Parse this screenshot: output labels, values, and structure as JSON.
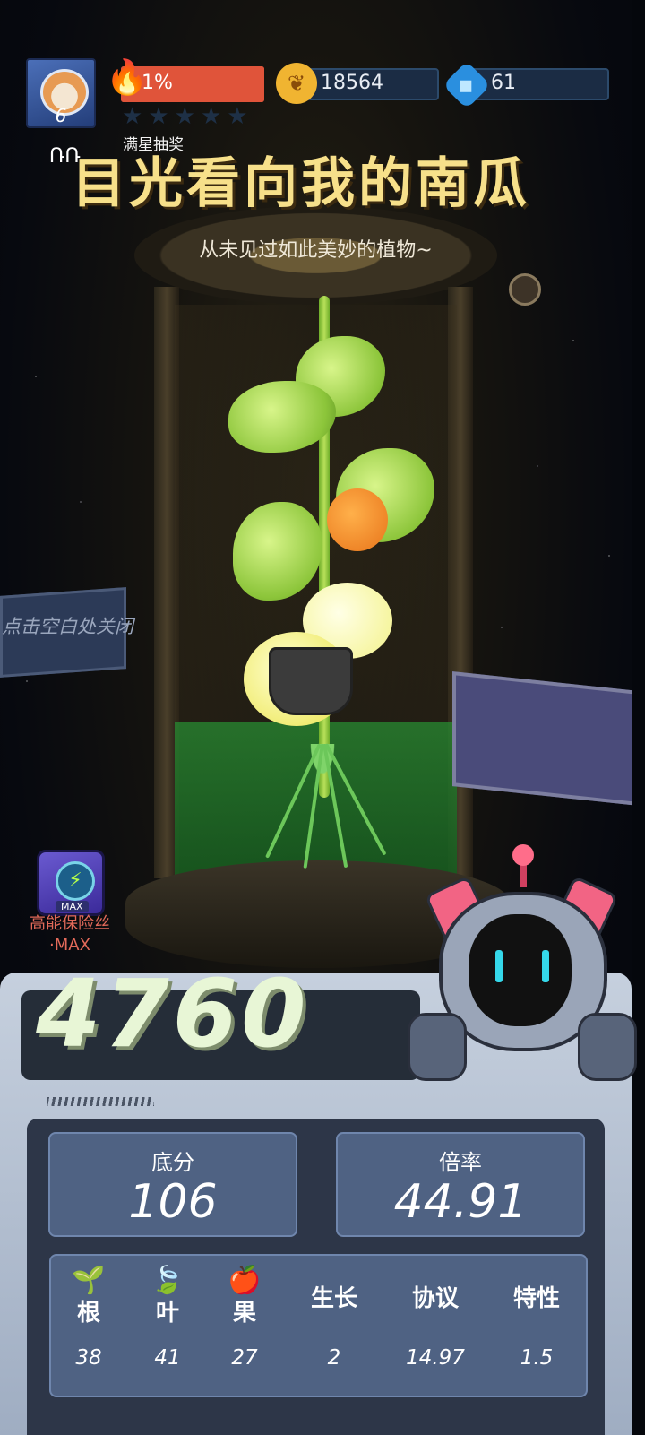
{
  "player": {
    "level": "6",
    "avatar_icon": "shiba-astronaut-icon"
  },
  "progress": {
    "percent_label": "1%",
    "percent": 1,
    "stars_filled": 0,
    "stars_total": 5
  },
  "currencies": [
    {
      "icon": "gold-coin-icon",
      "amount": "18564"
    },
    {
      "icon": "blue-gem-icon",
      "amount": "61"
    }
  ],
  "banner": {
    "label": "满星抽奖",
    "mark": "ՌՌ",
    "title": "目光看向我的南瓜",
    "subtitle": "从未见过如此美妙的植物~"
  },
  "hint": "点击空白处关闭",
  "item": {
    "name": "高能保险丝",
    "suffix": "·MAX",
    "badge": "MAX",
    "icon": "fuse-bolt-icon"
  },
  "score": {
    "total": "4760"
  },
  "stats": {
    "base_label": "底分",
    "base_value": "106",
    "multiplier_label": "倍率",
    "multiplier_value": "44.91"
  },
  "attributes": [
    {
      "icon": "root-icon",
      "label": "根",
      "value": "38"
    },
    {
      "icon": "leaf-icon",
      "label": "叶",
      "value": "41"
    },
    {
      "icon": "fruit-icon",
      "label": "果",
      "value": "27"
    },
    {
      "icon": "",
      "label": "生长",
      "value": "2"
    },
    {
      "icon": "",
      "label": "协议",
      "value": "14.97"
    },
    {
      "icon": "",
      "label": "特性",
      "value": "1.5"
    }
  ],
  "colors": {
    "title": "#f7e08a",
    "flame": "#e0543a",
    "panel": "#4f6283",
    "item_text": "#e36a5a"
  }
}
